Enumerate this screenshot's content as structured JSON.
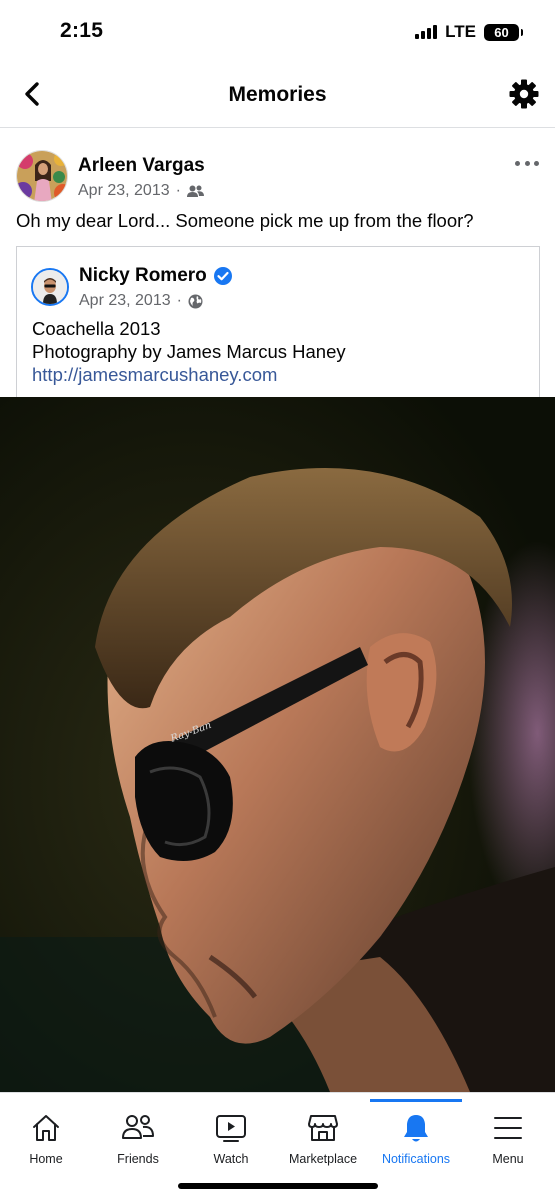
{
  "status_bar": {
    "time": "2:15",
    "network": "LTE",
    "battery": "60"
  },
  "header": {
    "title": "Memories",
    "back_icon": "chevron-left-icon",
    "settings_icon": "gear-icon"
  },
  "post": {
    "author": "Arleen Vargas",
    "date": "Apr 23, 2013",
    "audience_icon": "friends-icon",
    "text": "Oh my dear Lord... Someone pick me up from the floor?",
    "shared": {
      "author": "Nicky Romero",
      "verified": true,
      "date": "Apr 23, 2013",
      "audience_icon": "globe-icon",
      "line1": "Coachella 2013",
      "line2": "Photography by James Marcus Haney",
      "link": "http://jamesmarcushaney.com"
    }
  },
  "bottom_nav": {
    "items": [
      {
        "label": "Home",
        "icon": "home-icon",
        "active": false
      },
      {
        "label": "Friends",
        "icon": "friends-icon",
        "active": false
      },
      {
        "label": "Watch",
        "icon": "watch-icon",
        "active": false
      },
      {
        "label": "Marketplace",
        "icon": "marketplace-icon",
        "active": false
      },
      {
        "label": "Notifications",
        "icon": "bell-icon",
        "active": true
      },
      {
        "label": "Menu",
        "icon": "menu-icon",
        "active": false
      }
    ]
  },
  "colors": {
    "accent": "#1877f2",
    "link": "#385898",
    "secondary_text": "#65676b"
  }
}
